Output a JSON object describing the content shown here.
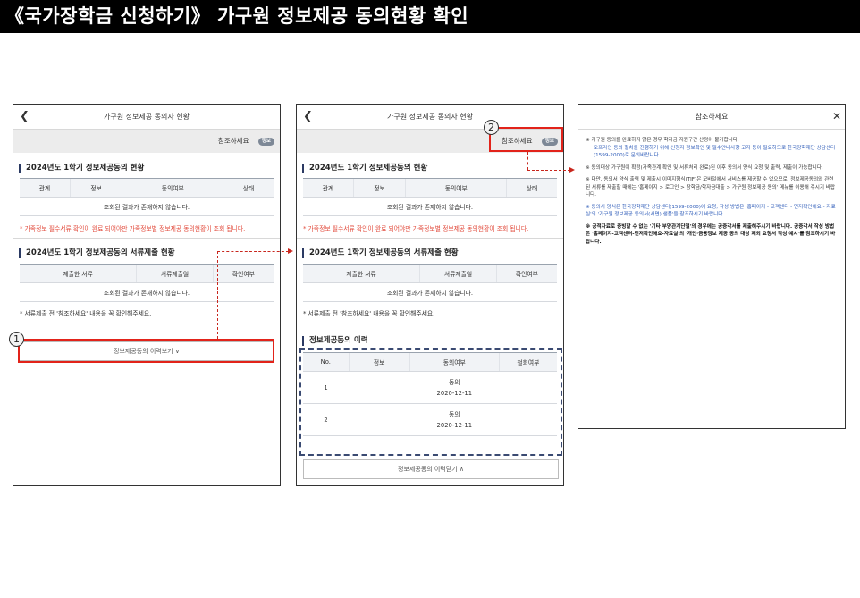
{
  "page_title": "《국가장학금 신청하기》 가구원 정보제공 동의현황 확인",
  "screen": {
    "header_title": "가구원 정보제공 동의자 현황",
    "back_icon": "chevron-left-icon",
    "reference_label": "참조하세요",
    "reference_badge": "정보",
    "section1_title": "2024년도 1학기 정보제공동의 현황",
    "table1_headers": [
      "관계",
      "정보",
      "동의여부",
      "상태"
    ],
    "empty_text": "조회된 결과가 존재하지 않습니다.",
    "family_note": "* 가족정보 필수서류 확인이 완료 되어야만 가족정보별 정보제공 동의현황이 조회 됩니다.",
    "section2_title": "2024년도 1학기 정보제공동의 서류제출 현황",
    "table2_headers": [
      "제출한 서류",
      "서류제출일",
      "확인여부"
    ],
    "doc_note": "* 서류제출 전 '참조하세요' 내용을 꼭 확인해주세요.",
    "history_open_label": "정보제공동의 이력보기",
    "history_close_label": "정보제공동의 이력닫기",
    "history_title": "정보제공동의 이력",
    "history_headers": [
      "No.",
      "정보",
      "동의여부",
      "철회여부"
    ],
    "history_rows": [
      {
        "no": "1",
        "info": "",
        "status": "동의",
        "date": "2020-12-11",
        "withdraw": ""
      },
      {
        "no": "2",
        "info": "",
        "status": "동의",
        "date": "2020-12-11",
        "withdraw": ""
      }
    ]
  },
  "notice_panel": {
    "title": "참조하세요",
    "close_icon": "close-icon",
    "p1_a": "※ 가구원 동의를 완료하지 않은 경우 학자금 지원구간 산정이 불가합니다.",
    "p1_b": "오프라인 동의 절차를 진행하기 위해 신청자 정보확인 및 필수안내사항 고지 등이 필요하므로 한국장학재단 상담센터(1599-2000)로 문의바랍니다.",
    "p2": "※ 동의대상 가구원이 확정(가족관계 확인 및 서류처리 완료)된 이후 동의서 양식 요청 및 출력, 제출이 가능합니다.",
    "p3": "※ 다만, 동의서 양식 출력 및 제출시 이미지형식(TIF)은 모바일에서 서비스를 제공할 수 없으므로, 정보제공동의와 관련된 서류를 제출할 때에는 '홈페이지 > 로그인 > 장학금/학자금대출 > 가구원 정보제공 동의' 메뉴를 이용해 주시기 바랍니다.",
    "p4": "※ 동의서 양식은 한국장학재단 상담센터(1599-2000)에 요청, 작성 방법은 '홈페이지 - 고객센터 - 면저확인해요 - 자료실'의 '가구원 정보제공 동의서(서면) 샘플'을 참조하시기 바랍니다.",
    "p5": "※ 공적자료로 증빙할 수 없는 '기타 부양관계단절'의 경우에는 공증각서를 제출해주시기 바랍니다. 공증각서 작성 방법은 '홈페이지-고객센터-먼저확인해요-자료실'의 '개인·금융정보 제공 동의 대상 제외 요청서 작성 예시'를 참조하시기 바랍니다."
  },
  "markers": {
    "step1": "1",
    "step2": "2"
  },
  "colors": {
    "highlight": "#e2231a",
    "arrow": "#c8261d",
    "navy": "#2b3a63",
    "note_red": "#e24a3b"
  }
}
